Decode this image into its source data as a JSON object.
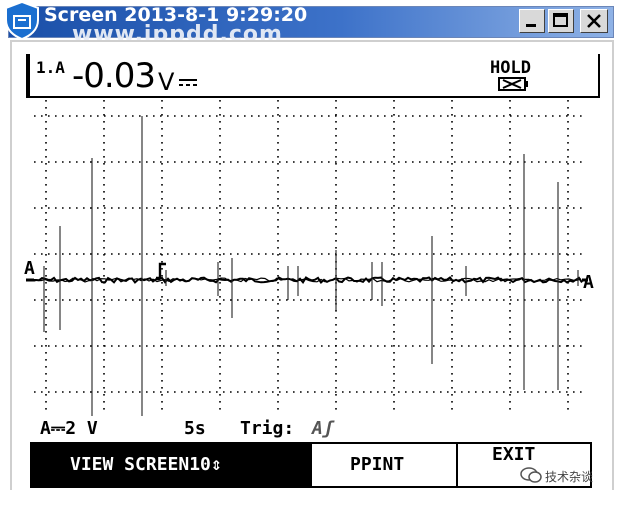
{
  "window": {
    "title": "Screen  2013-8-1  9:29:20",
    "watermark": "www.ippdd.com",
    "buttons": {
      "minimize": "_",
      "maximize": "□",
      "close": "✕"
    }
  },
  "reading": {
    "channel": "1.A",
    "value": "-0.03",
    "unit": "V",
    "coupling_icon": "dc-symbol-icon",
    "hold": "HOLD"
  },
  "scope": {
    "marker_left": "A",
    "marker_right": "A",
    "trace_color": "#000000",
    "grid_color": "#000000"
  },
  "info": {
    "scale": "A⎓2 V",
    "timebase": "5s",
    "trig_label": "Trig:",
    "trig_value": "Aʃ"
  },
  "softkeys": {
    "view": "VIEW SCREEN10⇕",
    "print": "PPINT",
    "exit": "EXIT"
  },
  "caption": "技术杂谈",
  "colors": {
    "titlebar_start": "#1a4fa8",
    "titlebar_end": "#8fb2e6",
    "background": "#ffffff",
    "softkey_active": "#000000"
  }
}
